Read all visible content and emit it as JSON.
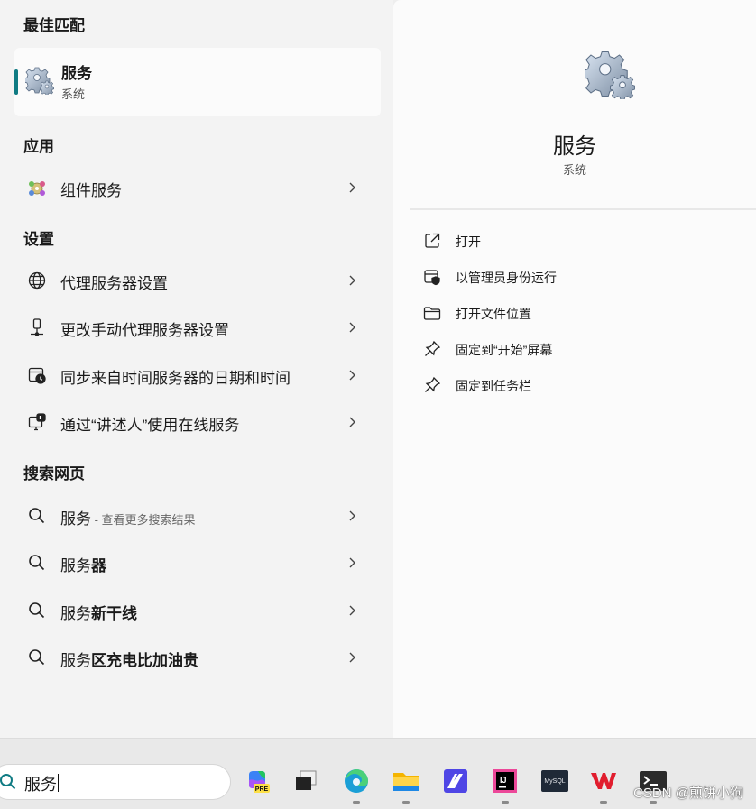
{
  "left": {
    "best_match_title": "最佳匹配",
    "best_match": {
      "title": "服务",
      "subtitle": "系统",
      "icon": "gear-icon"
    },
    "apps_title": "应用",
    "apps": [
      {
        "label": "组件服务",
        "icon": "component-services-icon"
      }
    ],
    "settings_title": "设置",
    "settings": [
      {
        "label": "代理服务器设置",
        "icon": "globe-icon"
      },
      {
        "label": "更改手动代理服务器设置",
        "icon": "network-device-icon"
      },
      {
        "label": "同步来自时间服务器的日期和时间",
        "icon": "calendar-clock-icon"
      },
      {
        "label": "通过“讲述人”使用在线服务",
        "icon": "narrator-icon"
      }
    ],
    "web_title": "搜索网页",
    "web": [
      {
        "prefix": "服务",
        "bold": "",
        "suffix": " - 查看更多搜索结果"
      },
      {
        "prefix": "服务",
        "bold": "器",
        "suffix": ""
      },
      {
        "prefix": "服务",
        "bold": "新干线",
        "suffix": ""
      },
      {
        "prefix": "服务",
        "bold": "区充电比加油贵",
        "suffix": ""
      }
    ]
  },
  "right": {
    "title": "服务",
    "subtitle": "系统",
    "actions": [
      {
        "label": "打开",
        "icon": "open-external-icon"
      },
      {
        "label": "以管理员身份运行",
        "icon": "run-as-admin-icon"
      },
      {
        "label": "打开文件位置",
        "icon": "folder-icon"
      },
      {
        "label": "固定到“开始”屏幕",
        "icon": "pin-icon"
      },
      {
        "label": "固定到任务栏",
        "icon": "pin-icon"
      }
    ]
  },
  "taskbar": {
    "search_value": "服务",
    "apps": [
      {
        "name": "copilot-pre-icon",
        "label": "PRE"
      },
      {
        "name": "task-view-icon"
      },
      {
        "name": "edge-icon"
      },
      {
        "name": "file-explorer-icon"
      },
      {
        "name": "jetbrains-icon"
      },
      {
        "name": "intellij-idea-icon",
        "label": "IJ"
      },
      {
        "name": "mysql-icon",
        "label": "MySQL"
      },
      {
        "name": "wps-icon"
      },
      {
        "name": "terminal-icon"
      }
    ],
    "watermark": "CSDN @煎饼小狗"
  },
  "colors": {
    "accent": "#0f7b83",
    "panel_left": "#f3f3f3",
    "panel_right": "#fbfbfb"
  }
}
